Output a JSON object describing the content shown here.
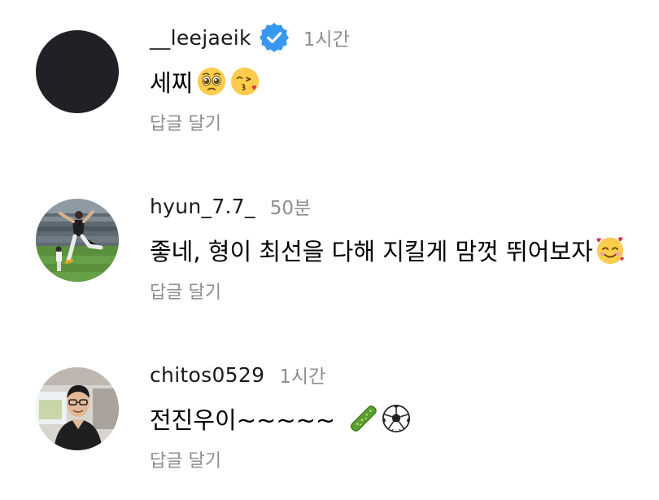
{
  "comments": [
    {
      "username": "__leejaeik",
      "verified": true,
      "time": "1시간",
      "text": "세찌",
      "emojis": [
        "pleading-face",
        "face-blowing-kiss"
      ],
      "reply_label": "답글 달기"
    },
    {
      "username": "hyun_7.7_",
      "verified": false,
      "time": "50분",
      "text": "좋네, 형이 최선을 다해 지킬게 맘껏 뛰어보자",
      "emojis": [
        "smiling-face-with-hearts"
      ],
      "reply_label": "답글 달기"
    },
    {
      "username": "chitos0529",
      "verified": false,
      "time": "1시간",
      "text": "전진우이~~~~~",
      "emojis": [
        "cucumber",
        "soccer-ball"
      ],
      "reply_label": "답글 달기"
    }
  ],
  "colors": {
    "verified_badge": "#3897f0",
    "secondary_text": "#8e8e8e",
    "avatar_dark": "#202027"
  }
}
